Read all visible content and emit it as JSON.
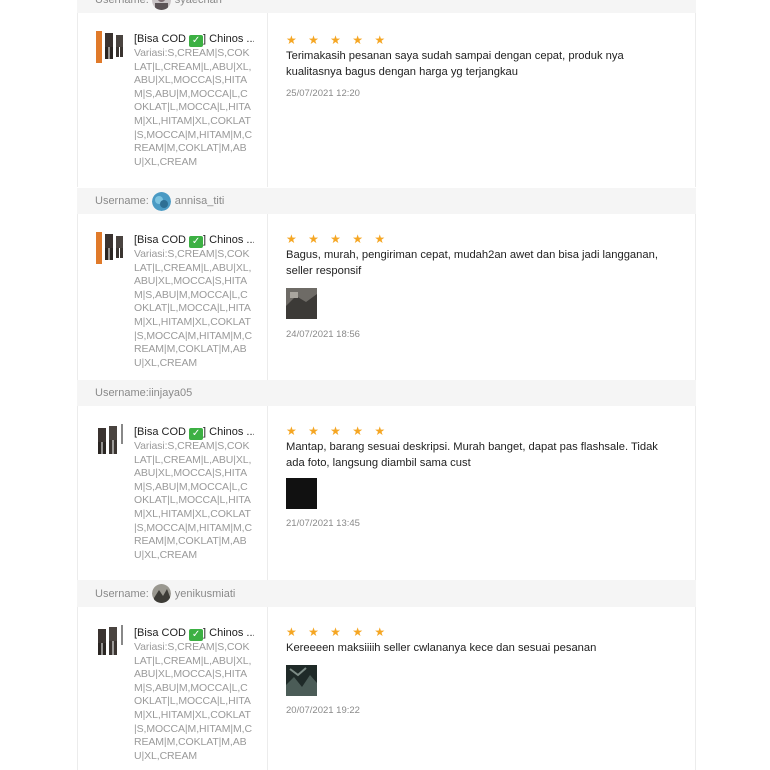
{
  "username_label": "Username:",
  "reviews": [
    {
      "username": "syaechah",
      "product_title": "[Bisa COD ✅] Chinos ...",
      "variant": "Variasi:S,CREAM|S,COKLAT|L,CREAM|L,ABU|XL,ABU|XL,MOCCA|S,HITAM|S,ABU|M,MOCCA|L,COKLAT|L,MOCCA|L,HITAM|XL,HITAM|XL,COKLAT|S,MOCCA|M,HITAM|M,CREAM|M,COKLAT|M,ABU|XL,CREAM",
      "rating": "★ ★ ★ ★ ★",
      "text": "Terimakasih pesanan saya sudah sampai dengan cepat, produk nya kualitasnya bagus dengan harga yg terjangkau",
      "date": "25/07/2021 12:20",
      "has_photo": false
    },
    {
      "username": "annisa_titi",
      "product_title": "[Bisa COD ✅] Chinos ...",
      "variant": "Variasi:S,CREAM|S,COKLAT|L,CREAM|L,ABU|XL,ABU|XL,MOCCA|S,HITAM|S,ABU|M,MOCCA|L,COKLAT|L,MOCCA|L,HITAM|XL,HITAM|XL,COKLAT|S,MOCCA|M,HITAM|M,CREAM|M,COKLAT|M,ABU|XL,CREAM",
      "rating": "★ ★ ★ ★ ★",
      "text": "Bagus, murah, pengiriman cepat, mudah2an awet dan bisa jadi langganan, seller responsif",
      "date": "24/07/2021 18:56",
      "has_photo": true
    },
    {
      "username": "iinjaya05",
      "product_title": "[Bisa COD ✅] Chinos ...",
      "variant": "Variasi:S,CREAM|S,COKLAT|L,CREAM|L,ABU|XL,ABU|XL,MOCCA|S,HITAM|S,ABU|M,MOCCA|L,COKLAT|L,MOCCA|L,HITAM|XL,HITAM|XL,COKLAT|S,MOCCA|M,HITAM|M,CREAM|M,COKLAT|M,ABU|XL,CREAM",
      "rating": "★ ★ ★ ★ ★",
      "text": "Mantap, barang sesuai deskripsi. Murah banget, dapat pas flashsale. Tidak ada foto, langsung diambil sama cust",
      "date": "21/07/2021 13:45",
      "has_photo": true
    },
    {
      "username": "yenikusmiati",
      "product_title": "[Bisa COD ✅] Chinos ...",
      "variant": "Variasi:S,CREAM|S,COKLAT|L,CREAM|L,ABU|XL,ABU|XL,MOCCA|S,HITAM|S,ABU|M,MOCCA|L,COKLAT|L,MOCCA|L,HITAM|XL,HITAM|XL,COKLAT|S,MOCCA|M,HITAM|M,CREAM|M,COKLAT|M,ABU|XL,CREAM",
      "rating": "★ ★ ★ ★ ★",
      "text": "Kereeeen maksiiiih seller cwlananya kece dan sesuai pesanan",
      "date": "20/07/2021 19:22",
      "has_photo": true
    }
  ],
  "colors": {
    "star": "#f5a623",
    "header_bg": "#f5f5f5",
    "muted": "#8a8a8a",
    "check": "#3cb043"
  }
}
